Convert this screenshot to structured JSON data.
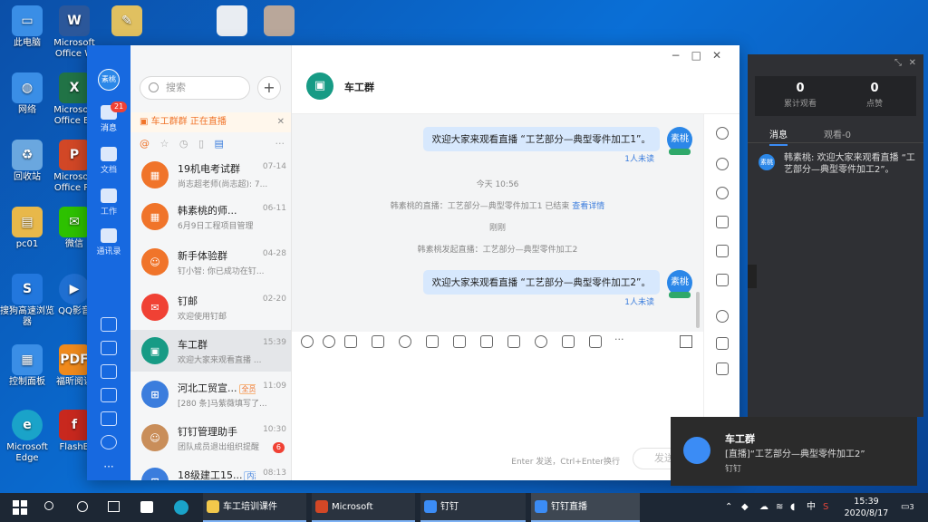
{
  "desktop": {
    "icons": [
      {
        "label": "此电脑",
        "color": "#3a8ee6"
      },
      {
        "label": "网络",
        "color": "#3a8ee6"
      },
      {
        "label": "回收站",
        "color": "#6aa7df"
      },
      {
        "label": "pc01",
        "color": "#e8b84a"
      },
      {
        "label": "搜狗高速浏览器",
        "color": "#2277dd"
      },
      {
        "label": "控制面板",
        "color": "#3a8ee6"
      },
      {
        "label": "Microsoft Edge",
        "color": "#1aa3c9"
      },
      {
        "label": "Microsoft Office W",
        "color": "#2b579a"
      },
      {
        "label": "Microsoft Office Ex",
        "color": "#217346"
      },
      {
        "label": "Microsoft Office Po",
        "color": "#d24726"
      },
      {
        "label": "微信",
        "color": "#2dc100"
      },
      {
        "label": "QQ影音",
        "color": "#1f6fd1"
      },
      {
        "label": "福昕阅读",
        "color": "#f08a1c"
      },
      {
        "label": "FlashB",
        "color": "#c8281e"
      }
    ]
  },
  "rail": {
    "avatar": "素桃",
    "items": [
      {
        "label": "消息",
        "badge": "21"
      },
      {
        "label": "文档"
      },
      {
        "label": "工作"
      },
      {
        "label": "通讯录"
      }
    ]
  },
  "conv": {
    "search_placeholder": "搜索",
    "plus": "+",
    "live_banner": "车工群群 正在直播",
    "live_close": "✕",
    "items": [
      {
        "name": "19机电考试群",
        "tag": "",
        "time": "07-14",
        "preview": "尚志超老师(尚志超): 7...",
        "color": "#f0742a",
        "avatar": "",
        "badge": ""
      },
      {
        "name": "韩素桃的师...",
        "tag": "",
        "time": "06-11",
        "preview": "6月9日工程项目管理",
        "color": "#f0742a",
        "avatar": "",
        "badge": ""
      },
      {
        "name": "新手体验群",
        "tag": "",
        "time": "04-28",
        "preview": "钉小智: 你已成功在钉...",
        "color": "#f0742a",
        "avatar": "",
        "badge": ""
      },
      {
        "name": "钉邮",
        "tag": "",
        "time": "02-20",
        "preview": "欢迎使用钉邮",
        "color": "#f04134",
        "avatar": "",
        "badge": ""
      },
      {
        "name": "车工群",
        "tag": "",
        "time": "15:39",
        "preview": "欢迎大家来观看直播 ...",
        "color": "#179b85",
        "avatar": "",
        "badge": ""
      },
      {
        "name": "河北工贸宣...",
        "tag": "全员",
        "time": "11:09",
        "preview": "[280 条]马紫薇填写了...",
        "color": "#3b7ddd",
        "avatar": "",
        "badge": ""
      },
      {
        "name": "钉钉管理助手",
        "tag": "",
        "time": "10:30",
        "preview": "团队成员退出组织提醒",
        "color": "#c98e5a",
        "avatar": "",
        "badge": "6"
      },
      {
        "name": "18级建工15...",
        "tag": "内部",
        "time": "08:13",
        "preview": "",
        "color": "#3b7ddd",
        "avatar": "",
        "badge": ""
      }
    ]
  },
  "chat": {
    "title": "车工群",
    "messages": [
      {
        "text": "欢迎大家来观看直播 “工艺部分—典型零件加工1”。",
        "unread": "1人未读",
        "sender": "素桃"
      },
      {
        "text": "欢迎大家来观看直播 “工艺部分—典型零件加工2”。",
        "unread": "1人未读",
        "sender": "素桃"
      }
    ],
    "sys_time": "今天 10:56",
    "sys_live_end": "韩素桃的直播：工艺部分—典型零件加工1 已结束",
    "sys_link": "查看详情",
    "sys_just_now": "刚刚",
    "sys_live_start": "韩素桃发起直播：工艺部分—典型零件加工2",
    "send_hint": "Enter 发送，Ctrl+Enter换行",
    "send_label": "发送"
  },
  "live_panel": {
    "stats": [
      {
        "num": "0",
        "label": "累计观看"
      },
      {
        "num": "0",
        "label": "点赞"
      }
    ],
    "tabs": [
      "消息",
      "观看-0"
    ],
    "msg_sender": "素桃",
    "msg_text": "韩素桃: 欢迎大家来观看直播 “工艺部分—典型零件加工2”。"
  },
  "toast": {
    "title": "车工群",
    "body": "[直播]“工艺部分—典型零件加工2”",
    "app": "钉钉"
  },
  "taskbar": {
    "apps": [
      {
        "label": "车工培训课件",
        "color": "#f2c84b"
      },
      {
        "label": "Microsoft PowerP...",
        "color": "#d24726"
      },
      {
        "label": "钉钉",
        "color": "#3b8cf5"
      },
      {
        "label": "钉钉直播",
        "color": "#3b8cf5"
      }
    ],
    "ime": "中",
    "time": "15:39",
    "date": "2020/8/17",
    "notif": "3"
  }
}
